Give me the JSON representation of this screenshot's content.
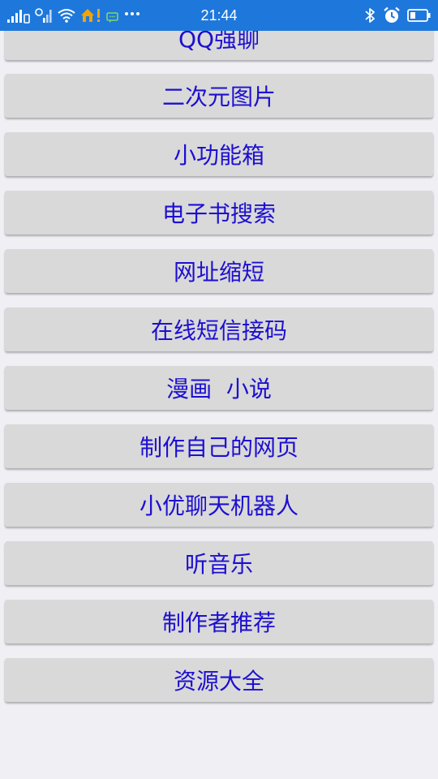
{
  "status_bar": {
    "time": "21:44",
    "background": "#1e78dc",
    "left_icons": [
      "signal-icon",
      "signal-icon-2",
      "wifi-icon",
      "home-alert-icon",
      "message-icon",
      "more-dots-icon"
    ],
    "right_icons": [
      "bluetooth-icon",
      "alarm-icon",
      "battery-icon"
    ]
  },
  "menu": {
    "text_color": "#1d0fd0",
    "button_color": "#d9d9d9",
    "items": [
      {
        "label": "QQ强聊"
      },
      {
        "label": "二次元图片"
      },
      {
        "label": "小功能箱"
      },
      {
        "label": "电子书搜索"
      },
      {
        "label": "网址缩短"
      },
      {
        "label": "在线短信接码"
      },
      {
        "label": "漫画  小说"
      },
      {
        "label": "制作自己的网页"
      },
      {
        "label": "小优聊天机器人"
      },
      {
        "label": "听音乐"
      },
      {
        "label": "制作者推荐"
      },
      {
        "label": "资源大全"
      }
    ]
  }
}
